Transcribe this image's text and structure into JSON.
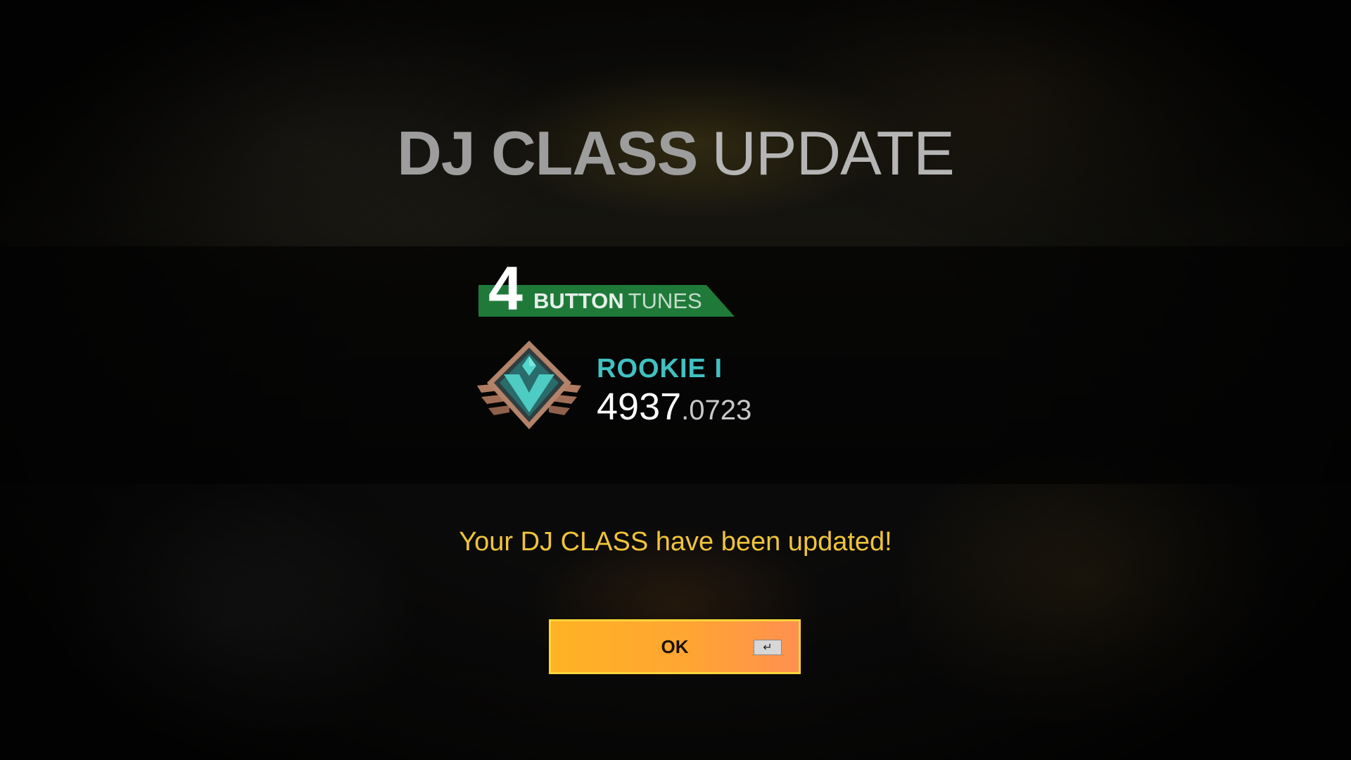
{
  "screen": {
    "title_bold": "DJ CLASS",
    "title_light": "UPDATE"
  },
  "mode": {
    "number": "4",
    "label_bold": "BUTTON",
    "label_light": "TUNES",
    "color": "#1f7a3a"
  },
  "rank": {
    "name": "ROOKIE I",
    "score_integer": "4937",
    "score_decimal": ".0723",
    "name_color": "#41c1c1",
    "badge_icon": "rookie-rank-emblem-icon"
  },
  "message": "Your DJ CLASS have been updated!",
  "ok_button": {
    "label": "OK",
    "key_glyph": "↵",
    "key_icon": "enter-key-icon"
  }
}
